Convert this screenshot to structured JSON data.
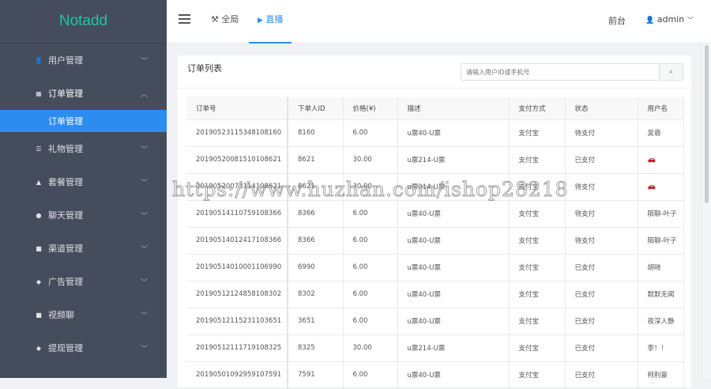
{
  "brand": "Notadd",
  "sidebar": {
    "items": [
      {
        "label": "用户管理",
        "icon": "user-icon",
        "glyph": "👤",
        "open": false
      },
      {
        "label": "订单管理",
        "icon": "list-icon",
        "glyph": "▦",
        "open": true
      },
      {
        "label": "礼物管理",
        "icon": "gift-icon",
        "glyph": "☰"
      },
      {
        "label": "套餐管理",
        "icon": "flask-icon",
        "glyph": "▲"
      },
      {
        "label": "聊天管理",
        "icon": "chat-icon",
        "glyph": "●"
      },
      {
        "label": "渠道管理",
        "icon": "folder-icon",
        "glyph": "■"
      },
      {
        "label": "广告管理",
        "icon": "tag-icon",
        "glyph": "◆"
      },
      {
        "label": "视频聊",
        "icon": "folder-icon",
        "glyph": "■"
      },
      {
        "label": "提现管理",
        "icon": "tag-icon",
        "glyph": "◆"
      }
    ],
    "sub_active": "订单管理"
  },
  "header": {
    "tabs": [
      {
        "label": "全局",
        "icon": "tools-icon",
        "glyph": "⚒"
      },
      {
        "label": "直播",
        "icon": "play-icon",
        "glyph": "▶"
      }
    ],
    "frontend": "前台",
    "user": "admin"
  },
  "card": {
    "title": "订单列表",
    "search_placeholder": "请输入用户ID或手机号"
  },
  "table": {
    "columns": [
      "订单号",
      "下单人ID",
      "价格(¥)",
      "描述",
      "支付方式",
      "状态",
      "用户名"
    ],
    "rows": [
      [
        "20190523115348108160",
        "8160",
        "6.00",
        "u票40-U票",
        "支付宝",
        "待支付",
        "吴蓉"
      ],
      [
        "20190520081510108621",
        "8621",
        "30.00",
        "u票214-U票",
        "支付宝",
        "已支付",
        "🚗"
      ],
      [
        "20190520073114108621",
        "8621",
        "30.00",
        "u票214-U票",
        "支付宝",
        "待支付",
        "🚗"
      ],
      [
        "20190514110759108366",
        "8366",
        "6.00",
        "u票40-U票",
        "支付宝",
        "待支付",
        "陌聊-叶子"
      ],
      [
        "20190514012417108366",
        "8366",
        "6.00",
        "u票40-U票",
        "支付宝",
        "待支付",
        "陌聊-叶子"
      ],
      [
        "20190514010001106990",
        "6990",
        "6.00",
        "u票40-U票",
        "支付宝",
        "已支付",
        "胡晓"
      ],
      [
        "20190512124858108302",
        "8302",
        "6.00",
        "u票40-U票",
        "支付宝",
        "已支付",
        "默默无闻"
      ],
      [
        "20190512115231103651",
        "3651",
        "6.00",
        "u票40-U票",
        "支付宝",
        "已支付",
        "夜深人静"
      ],
      [
        "20190512111719108325",
        "8325",
        "30.00",
        "u票214-U票",
        "支付宝",
        "已支付",
        "李！！"
      ],
      [
        "20190501092959107591",
        "7591",
        "6.00",
        "u票40-U票",
        "支付宝",
        "已支付",
        "柯利豪"
      ]
    ]
  },
  "watermark": "https://www.huzhan.com/ishop28218"
}
